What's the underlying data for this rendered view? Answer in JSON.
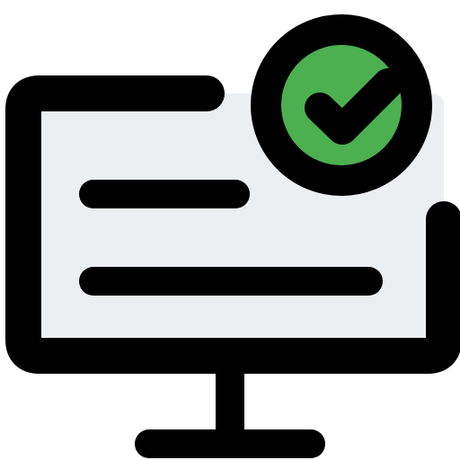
{
  "icon": {
    "name": "computer-check-icon",
    "parts": {
      "monitor": "monitor-icon",
      "stand": "monitor-stand-icon",
      "text_lines": "text-lines-icon",
      "badge": "check-badge-icon",
      "check": "checkmark-icon"
    }
  },
  "colors": {
    "outline": "#000000",
    "screen_fill": "#eceff1",
    "badge_fill": "#4caf50",
    "background": "#ffffff"
  }
}
